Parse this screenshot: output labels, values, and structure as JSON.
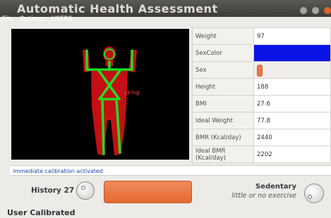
{
  "window": {
    "title": "Automatic Health Assessment",
    "menu": [
      "File",
      "Options",
      "USERS"
    ],
    "controls": [
      "minimize-icon",
      "maximize-icon",
      "close-icon"
    ]
  },
  "video": {
    "overlay_label": "cking",
    "colors": {
      "silhouette": "#c40f14",
      "skeleton": "#22dd22",
      "label": "#ff4040"
    }
  },
  "metrics": [
    {
      "label": "Weight",
      "value": "97"
    },
    {
      "label": "SexColor",
      "value": "",
      "color": "#0a14e6"
    },
    {
      "label": "Sex",
      "value": "",
      "slider_level": 0.05
    },
    {
      "label": "Height",
      "value": "188"
    },
    {
      "label": "BMI",
      "value": "27.6"
    },
    {
      "label": "Ideal Weight",
      "value": "77.8"
    },
    {
      "label": "BMR (Kcal/day)",
      "value": "2440"
    },
    {
      "label": "Ideal BMR (Kcal/day)",
      "value": "2202"
    }
  ],
  "status_message": "immediate calibration activated",
  "history": {
    "label": "History 27"
  },
  "activity": {
    "level": "Sedentary",
    "description": "little or no exercise"
  },
  "calibration_status": "User Calibrated",
  "colors": {
    "accent_bar": "#ea743f",
    "status_text": "#2244aa"
  }
}
